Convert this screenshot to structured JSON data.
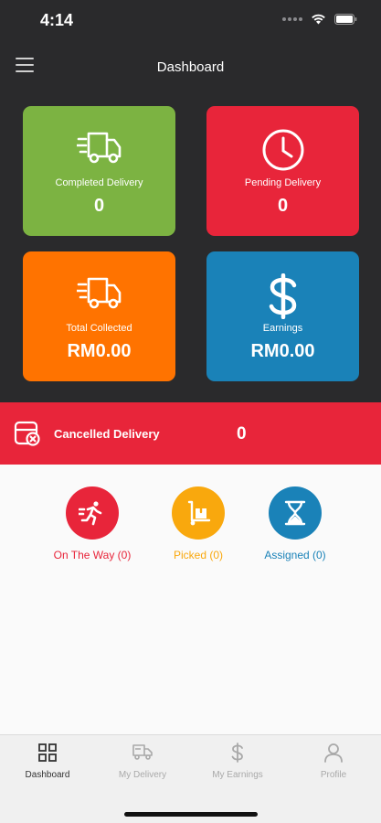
{
  "status_bar": {
    "time": "4:14",
    "icons": [
      "signal-icon",
      "wifi-icon",
      "battery-icon"
    ]
  },
  "header": {
    "title": "Dashboard",
    "menu_icon": "hamburger-menu-icon"
  },
  "cards": [
    {
      "label": "Completed Delivery",
      "value": "0",
      "icon": "delivery-truck-icon",
      "color": "#7cb342"
    },
    {
      "label": "Pending Delivery",
      "value": "0",
      "icon": "clock-icon",
      "color": "#e8253a"
    },
    {
      "label": "Total Collected",
      "value": "RM0.00",
      "icon": "delivery-truck-icon",
      "color": "#ff7300"
    },
    {
      "label": "Earnings",
      "value": "RM0.00",
      "icon": "dollar-icon",
      "color": "#1a82b8"
    }
  ],
  "cancelled": {
    "label": "Cancelled Delivery",
    "value": "0",
    "icon": "cancelled-box-icon",
    "color": "#e8253a"
  },
  "statuses": [
    {
      "label": "On The Way (0)",
      "icon": "runner-icon",
      "color": "#e8253a"
    },
    {
      "label": "Picked (0)",
      "icon": "hand-truck-icon",
      "color": "#f9a80d"
    },
    {
      "label": "Assigned (0)",
      "icon": "hourglass-icon",
      "color": "#1a82b8"
    }
  ],
  "tabs": [
    {
      "label": "Dashboard",
      "icon": "grid-icon",
      "active": true
    },
    {
      "label": "My Delivery",
      "icon": "truck-icon",
      "active": false
    },
    {
      "label": "My Earnings",
      "icon": "dollar-icon",
      "active": false
    },
    {
      "label": "Profile",
      "icon": "user-icon",
      "active": false
    }
  ]
}
